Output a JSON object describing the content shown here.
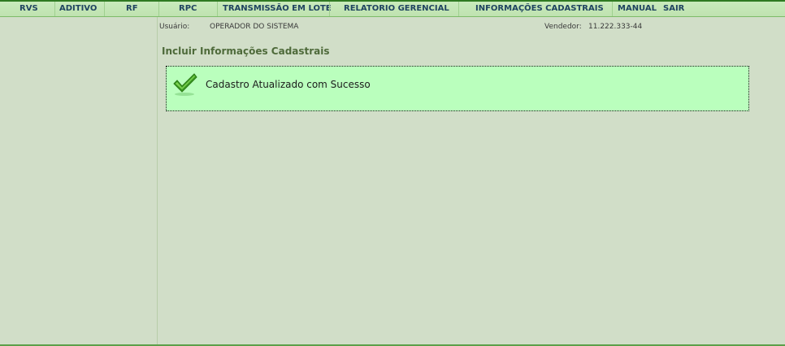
{
  "menu": {
    "items": [
      {
        "label": "RVS"
      },
      {
        "label": "ADITIVO"
      },
      {
        "label": "RF"
      },
      {
        "label": "RPC"
      },
      {
        "label": "TRANSMISSÃO EM LOTE"
      },
      {
        "label": "RELATORIO GERENCIAL"
      },
      {
        "label": "INFORMAÇÕES CADASTRAIS"
      },
      {
        "label": "MANUAL"
      },
      {
        "label": "SAIR"
      }
    ]
  },
  "info": {
    "user_label": "Usuário:",
    "user_value": "OPERADOR DO SISTEMA",
    "vendor_label": "Vendedor:",
    "vendor_value": "11.222.333-44"
  },
  "page": {
    "title": "Incluir Informações Cadastrais"
  },
  "message": {
    "text": "Cadastro Atualizado com Sucesso",
    "icon": "check-icon",
    "background": "#baffbd"
  },
  "colors": {
    "menu_text": "#1f4460",
    "title_text": "#4e6a3a",
    "page_background": "#d1dec8"
  }
}
